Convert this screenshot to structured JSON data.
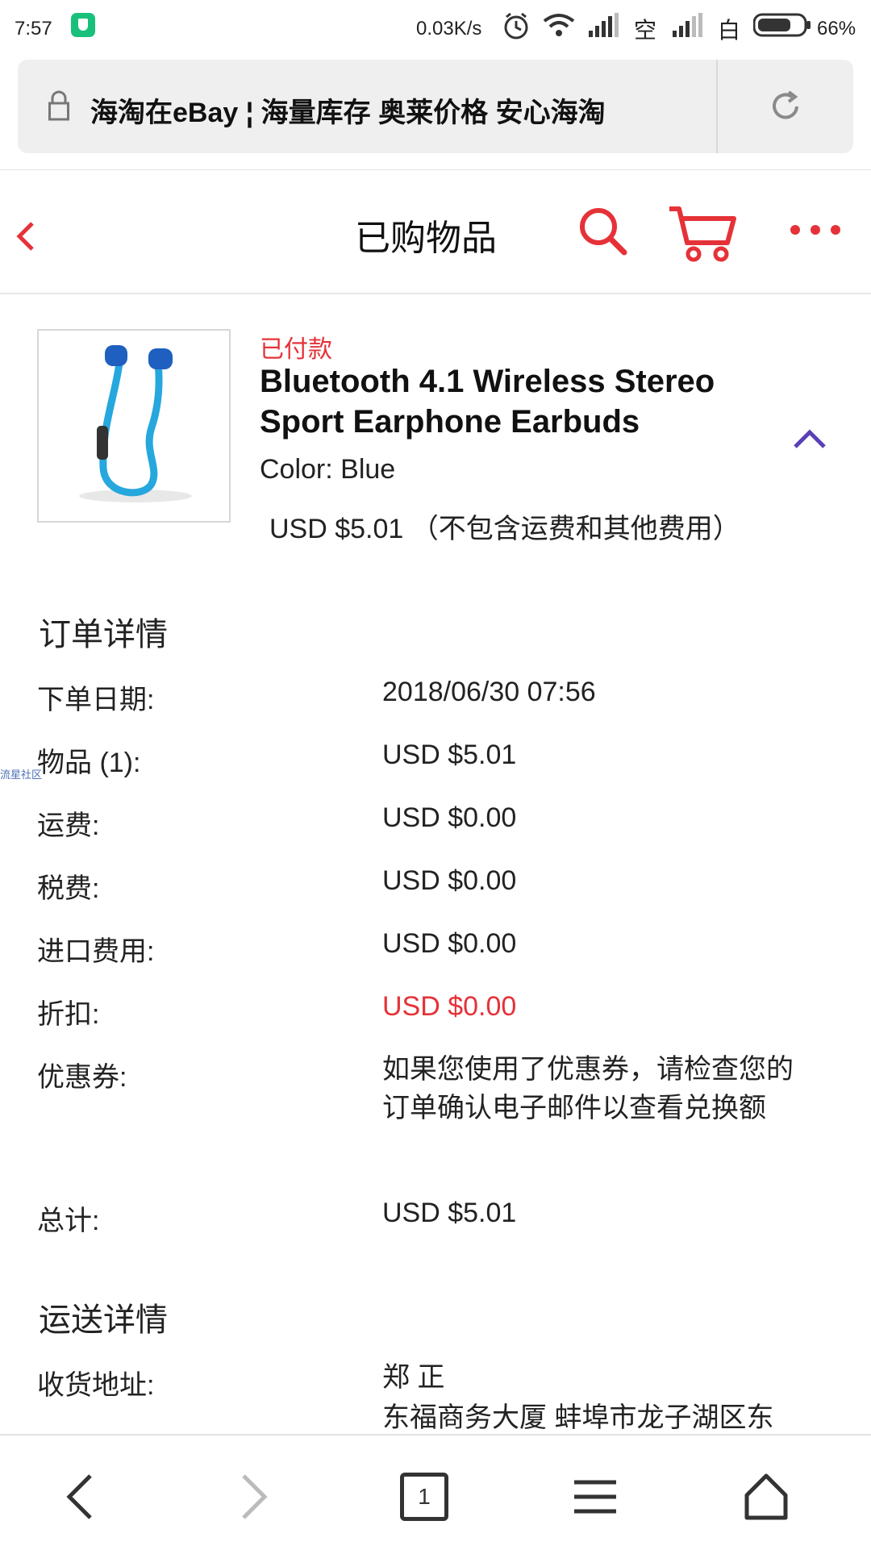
{
  "status_bar": {
    "time": "7:57",
    "network_speed": "0.03K/s",
    "carrier1": "空",
    "carrier2": "白",
    "battery": "66%"
  },
  "browser": {
    "page_title": "海淘在eBay ¦ 海量库存 奥莱价格 安心海淘"
  },
  "header": {
    "title": "已购物品"
  },
  "product": {
    "status": "已付款",
    "title": "Bluetooth 4.1 Wireless Stereo Sport Earphone Earbuds",
    "color": "Color: Blue",
    "price": "USD $5.01 （不包含运费和其他费用）"
  },
  "order_details": {
    "heading": "订单详情",
    "rows": [
      {
        "label": "下单日期:",
        "value": "2018/06/30 07:56"
      },
      {
        "label": "物品 (1):",
        "value": "USD $5.01"
      },
      {
        "label": "运费:",
        "value": "USD $0.00"
      },
      {
        "label": "税费:",
        "value": "USD $0.00"
      },
      {
        "label": "进口费用:",
        "value": "USD $0.00"
      },
      {
        "label": "折扣:",
        "value": "USD $0.00"
      },
      {
        "label": "优惠券:",
        "value": "如果您使用了优惠券，请检查您的订单确认电子邮件以查看兑换额"
      },
      {
        "label": "总计:",
        "value": "USD $5.01"
      }
    ]
  },
  "shipping_details": {
    "heading": "运送详情",
    "address_label": "收货地址:",
    "address_name": "郑 正",
    "address_line": "东福商务大厦 蚌埠市龙子湖区东"
  },
  "watermark": "流星社区",
  "bottom_nav": {
    "tabs_count": "1"
  },
  "colors": {
    "accent_red": "#e53238",
    "chevron_purple": "#5a3fb5"
  }
}
